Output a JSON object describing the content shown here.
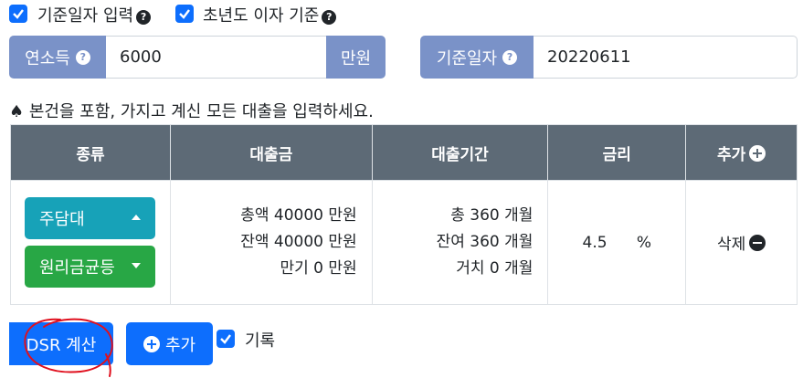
{
  "options": {
    "manual_date_label": "기준일자 입력",
    "first_year_interest_label": "초년도 이자 기준"
  },
  "income": {
    "label": "연소득",
    "value": "6000",
    "unit": "만원"
  },
  "base_date": {
    "label": "기준일자",
    "value": "20220611"
  },
  "notice": "♠ 본건을 포함, 가지고 계신 모든 대출을 입력하세요.",
  "table": {
    "headers": [
      "종류",
      "대출금",
      "대출기간",
      "금리",
      "추가"
    ],
    "row": {
      "type": "주담대",
      "repayment": "원리금균등",
      "amount_lines": [
        {
          "prefix": "총액",
          "value": "40000",
          "unit": "만원"
        },
        {
          "prefix": "잔액",
          "value": "40000",
          "unit": "만원"
        },
        {
          "prefix": "만기",
          "value": "0",
          "unit": "만원"
        }
      ],
      "period_lines": [
        {
          "prefix": "총",
          "value": "360",
          "unit": "개월"
        },
        {
          "prefix": "잔여",
          "value": "360",
          "unit": "개월"
        },
        {
          "prefix": "거치",
          "value": "0",
          "unit": "개월"
        }
      ],
      "rate": "4.5",
      "rate_unit": "%",
      "delete_label": "삭제"
    }
  },
  "footer": {
    "calc_button": "DSR 계산",
    "add_button": "추가",
    "record_label": "기록"
  },
  "colors": {
    "primary": "#0d6efd",
    "addon": "#7a92c8",
    "header": "#5d6a76",
    "teal": "#17a2b8",
    "green": "#28a745",
    "annotation": "#e0101e"
  }
}
